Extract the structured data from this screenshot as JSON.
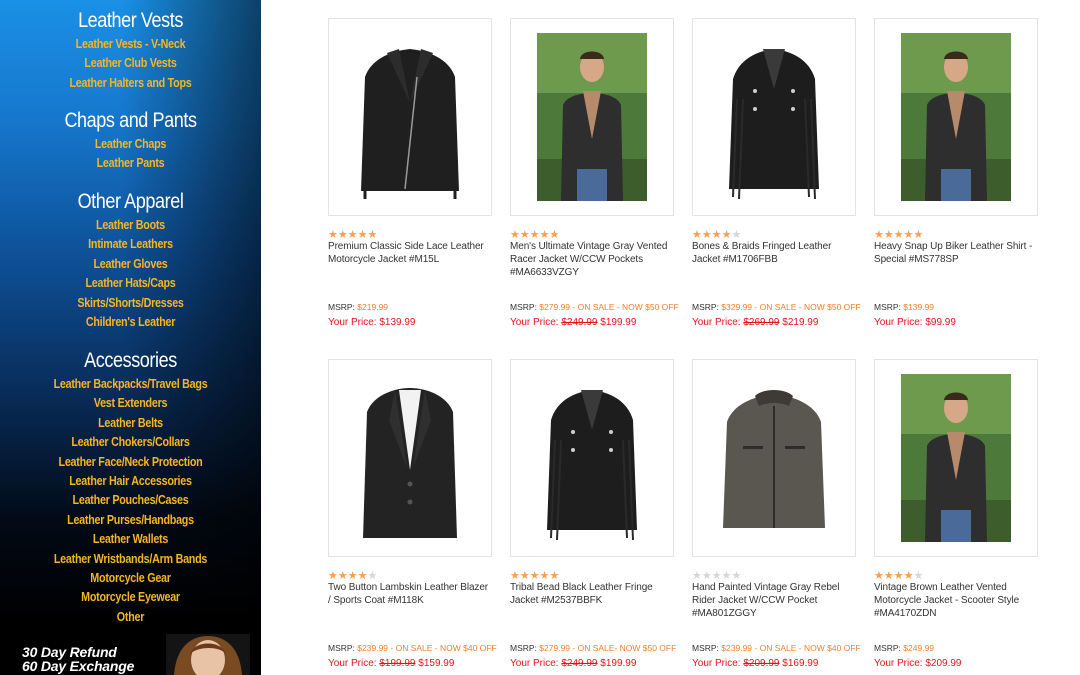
{
  "sidebar": {
    "vests": {
      "heading": "Leather Vests",
      "links": [
        "Leather Vests - V-Neck",
        "Leather Club Vests",
        "Leather Halters and Tops"
      ]
    },
    "chaps": {
      "heading": "Chaps and Pants",
      "links": [
        "Leather Chaps",
        "Leather Pants"
      ]
    },
    "apparel": {
      "heading": "Other Apparel",
      "links": [
        "Leather Boots",
        "Intimate Leathers",
        "Leather Gloves",
        "Leather Hats/Caps",
        "Skirts/Shorts/Dresses",
        "Children's Leather"
      ]
    },
    "accessories": {
      "heading": "Accessories",
      "links": [
        "Leather Backpacks/Travel Bags",
        "Vest Extenders",
        "Leather Belts",
        "Leather Chokers/Collars",
        "Leather Face/Neck Protection",
        "Leather Hair Accessories",
        "Leather Pouches/Cases",
        "Leather Purses/Handbags",
        "Leather Wallets",
        "Leather Wristbands/Arm Bands",
        "Motorcycle Gear",
        "Motorcycle Eyewear",
        "Other"
      ]
    },
    "promo": {
      "line1": "30 Day Refund",
      "line2": "60 Day Exchange"
    }
  },
  "labels": {
    "msrp": "MSRP:",
    "your_price": "Your Price:"
  },
  "products": [
    {
      "title": "Premium Classic Side Lace Leather Motorcycle Jacket #M15L",
      "rating": 5,
      "msrp": "$219.99",
      "sale_note": "",
      "old_price": "",
      "price": "$139.99",
      "image": "black-leather-jacket"
    },
    {
      "title": "Men's Ultimate Vintage Gray Vented Racer Jacket W/CCW Pockets #MA6633VZGY",
      "rating": 5,
      "msrp": "$279.99",
      "sale_note": " - ON SALE - NOW $50 OFF",
      "old_price": "$249.99",
      "price": "$199.99",
      "image": "model-photo"
    },
    {
      "title": "Bones & Braids Fringed Leather Jacket #M1706FBB",
      "rating": 4,
      "msrp": "$329.99",
      "sale_note": " - ON SALE - NOW $50 OFF",
      "old_price": "$269.99",
      "price": "$219.99",
      "image": "fringed-jacket"
    },
    {
      "title": "Heavy Snap Up Biker Leather Shirt - Special #MS778SP",
      "rating": 5,
      "msrp": "$139.99",
      "sale_note": "",
      "old_price": "",
      "price": "$99.99",
      "image": "model-photo"
    },
    {
      "title": "Two Button Lambskin Leather Blazer / Sports Coat #M118K",
      "rating": 4,
      "msrp": "$239.99",
      "sale_note": " - ON SALE - NOW $40 OFF",
      "old_price": "$199.99",
      "price": "$159.99",
      "image": "blazer"
    },
    {
      "title": "Tribal Bead Black Leather Fringe Jacket #M2537BBFK",
      "rating": 5,
      "msrp": "$279.99",
      "sale_note": " - ON SALE- NOW $50 OFF",
      "old_price": "$249.99",
      "price": "$199.99",
      "image": "fringed-jacket"
    },
    {
      "title": "Hand Painted Vintage Gray Rebel Rider Jacket W/CCW Pocket #MA801ZGGY",
      "rating": 0,
      "msrp": "$239.99",
      "sale_note": " - ON SALE - NOW $40 OFF",
      "old_price": "$209.99",
      "price": "$169.99",
      "image": "gray-jacket"
    },
    {
      "title": "Vintage Brown Leather Vented Motorcycle Jacket - Scooter Style #MA4170ZDN",
      "rating": 4,
      "msrp": "$249.99",
      "sale_note": "",
      "old_price": "",
      "price": "$209.99",
      "image": "model-photo"
    }
  ],
  "colors": {
    "sidebar_link": "#f4b623",
    "star_on": "#f89f50",
    "msrp_value": "#f0802e",
    "price": "#e4141b"
  }
}
